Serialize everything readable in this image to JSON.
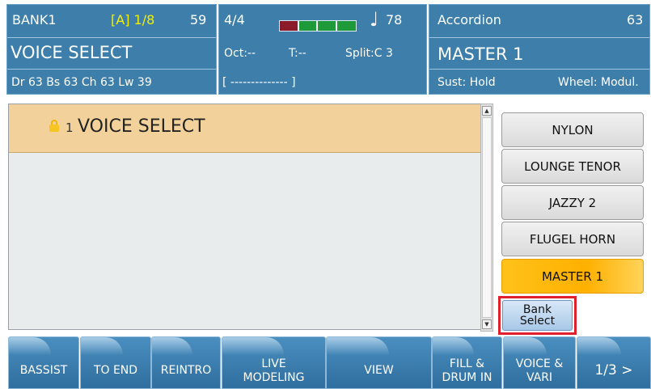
{
  "header": {
    "left": {
      "bank": "BANK1",
      "bank_slot": "[A] 1/8",
      "bank_number": "59",
      "title": "VOICE SELECT",
      "levels": "Dr 63  Bs 63  Ch 63  Lw 39"
    },
    "middle": {
      "time_signature": "4/4",
      "tempo": "78",
      "meter_colors": [
        "#8b1a2a",
        "#1f9a3a",
        "#1f9a3a",
        "#1f9a3a"
      ],
      "octave": "Oct:--",
      "transpose": "T:--",
      "split": "Split:C 3",
      "chord": "[ -------------- ]"
    },
    "right": {
      "category": "Accordion",
      "program": "63",
      "voice": "MASTER 1",
      "sustain": "Sust: Hold",
      "wheel": "Wheel: Modul."
    }
  },
  "list": {
    "number": "1",
    "title": "VOICE SELECT"
  },
  "voices": [
    {
      "label": "NYLON",
      "selected": false
    },
    {
      "label": "LOUNGE TENOR",
      "selected": false
    },
    {
      "label": "JAZZY 2",
      "selected": false
    },
    {
      "label": "FLUGEL HORN",
      "selected": false
    },
    {
      "label": "MASTER 1",
      "selected": true
    }
  ],
  "bank_select": {
    "line1": "Bank",
    "line2": "Select"
  },
  "bottom_bar": [
    {
      "label": "BASSIST"
    },
    {
      "label": "TO END"
    },
    {
      "label": "REINTRO"
    },
    {
      "label": "LIVE\nMODELING"
    },
    {
      "label": "VIEW"
    },
    {
      "label": "FILL &\nDRUM IN"
    },
    {
      "label": "VOICE &\nVARI"
    },
    {
      "label": "1/3 >"
    }
  ],
  "colors": {
    "header_bg": "#3d7eab",
    "highlight_yellow": "#f4f000",
    "selected_voice": "#ffb000",
    "list_header": "#f2d29a",
    "bank_select_outline": "#e0202d"
  }
}
